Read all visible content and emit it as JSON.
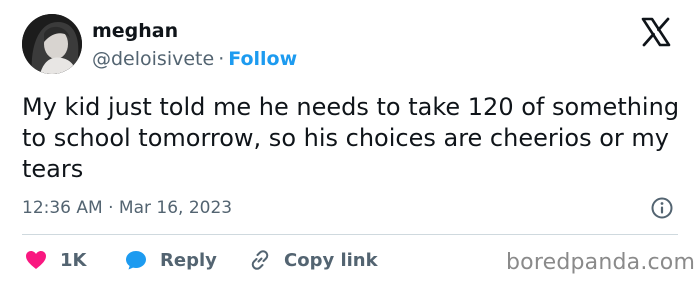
{
  "author": {
    "name": "meghan",
    "handle": "@deloisivete",
    "separator": "·",
    "follow_label": "Follow"
  },
  "tweet": {
    "text": "My kid just told me he needs to take 120 of something to school tomorrow, so his choices are cheerios or my tears",
    "time": "12:36 AM · Mar 16, 2023"
  },
  "actions": {
    "like_count": "1K",
    "reply_label": "Reply",
    "copy_label": "Copy link"
  },
  "watermark": "boredpanda.com",
  "colors": {
    "link_blue": "#1d9bf0",
    "like_pink": "#f91880",
    "muted_gray": "#536471"
  },
  "icons": [
    "x-logo-icon",
    "info-icon",
    "heart-icon",
    "speech-bubble-icon",
    "link-icon"
  ]
}
